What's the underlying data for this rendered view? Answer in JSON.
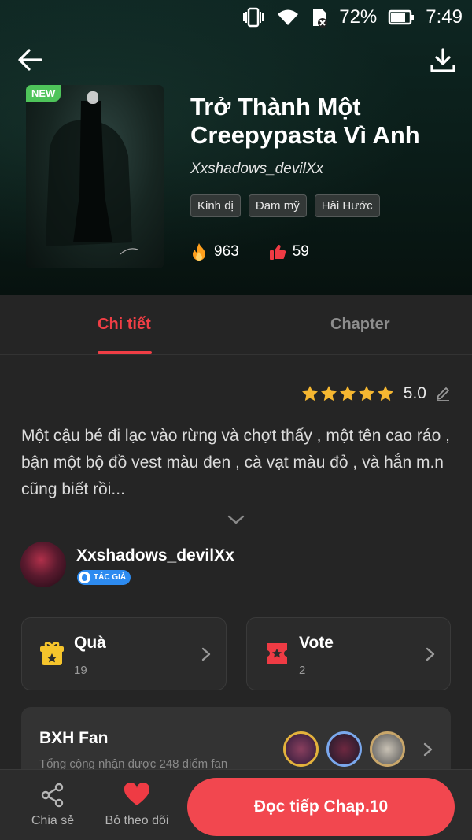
{
  "status_bar": {
    "battery": "72%",
    "time": "7:49"
  },
  "story": {
    "badge": "NEW",
    "title": "Trở Thành Một Creepypasta Vì Anh",
    "author": "Xxshadows_devilXx",
    "tags": [
      "Kinh dị",
      "Đam mỹ",
      "Hài Hước"
    ],
    "views": "963",
    "likes": "59"
  },
  "tabs": {
    "detail": "Chi tiết",
    "chapter": "Chapter"
  },
  "rating": {
    "value": "5.0",
    "stars": 5
  },
  "description": "Một cậu bé đi lạc vào rừng và chợt thấy , một tên cao ráo , bận một bộ đồ vest màu đen , cà vạt màu đỏ , và hắn m.n cũng biết rồi...",
  "author_section": {
    "name": "Xxshadows_devilXx",
    "badge": "TÁC GIẢ"
  },
  "cards": {
    "gift": {
      "title": "Quà",
      "count": "19"
    },
    "vote": {
      "title": "Vote",
      "count": "2"
    }
  },
  "fan_ranking": {
    "title": "BXH Fan",
    "subtitle": "Tổng cộng nhận được 248 điểm fan"
  },
  "bottom_bar": {
    "share": "Chia sẻ",
    "unfollow": "Bỏ theo dõi",
    "read_button": "Đọc tiếp Chap.10"
  },
  "colors": {
    "accent": "#f03e45",
    "button": "#f2474f",
    "badge_new": "#4ec45a",
    "star": "#f5b731",
    "author_badge": "#2d8bf0"
  },
  "icons": [
    "back-arrow-icon",
    "download-icon",
    "fire-icon",
    "thumbs-up-icon",
    "star-icon",
    "edit-icon",
    "chevron-down-icon",
    "gift-icon",
    "ticket-icon",
    "chevron-right-icon",
    "share-icon",
    "heart-icon"
  ]
}
